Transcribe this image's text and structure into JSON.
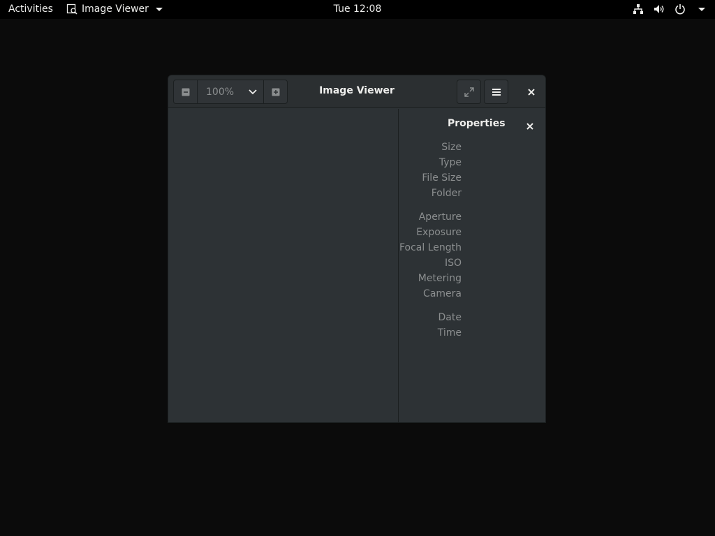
{
  "topbar": {
    "activities": "Activities",
    "app_name": "Image Viewer",
    "clock": "Tue 12:08"
  },
  "window": {
    "title": "Image Viewer",
    "zoom_value": "100%"
  },
  "properties": {
    "title": "Properties",
    "labels": [
      "Size",
      "Type",
      "File Size",
      "Folder",
      "Aperture",
      "Exposure",
      "Focal Length",
      "ISO",
      "Metering",
      "Camera",
      "Date",
      "Time"
    ]
  }
}
